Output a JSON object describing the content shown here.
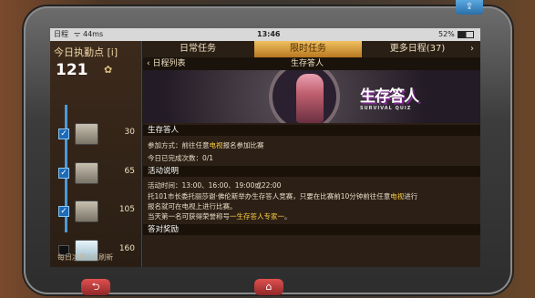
{
  "status": {
    "carrier": "日程",
    "time_wifi": "44ms",
    "clock": "13:46",
    "battery": "52%"
  },
  "left": {
    "title": "今日执勤点",
    "info": "[i]",
    "points": "121",
    "items": [
      {
        "value": "30",
        "checked": true
      },
      {
        "value": "65",
        "checked": true
      },
      {
        "value": "105",
        "checked": true
      },
      {
        "value": "160",
        "checked": false
      }
    ],
    "footer": "每日凌晨3点刷新"
  },
  "tabs": [
    "日常任务",
    "限时任务",
    "更多日程(37)"
  ],
  "subheader": {
    "back_label": "日程列表",
    "title": "生存答人"
  },
  "banner": {
    "logo": "生存答人",
    "logo_en": "SURVIVAL QUIZ"
  },
  "detail": {
    "name": "生存答人",
    "method_prefix": "参加方式：前往任意",
    "method_hl": "电视",
    "method_suffix": "报名参加比赛",
    "progress": "今日已完成次数：0/1",
    "section2": "活动说明",
    "time": "活动时间：13:00、16:00、19:00或22:00",
    "desc1a": "托101市长委托丽莎谢·佛伦斯举办生存答人竞赛，只要在比赛前10分钟前往任意",
    "desc1b": "电视",
    "desc1c": "进行",
    "desc2": "报名就可在电视上进行比赛。",
    "desc3a": "当天第一名可获得荣誉称号",
    "desc3b": "一生存答人专家一",
    "desc3c": "。",
    "section3": "答对奖励"
  },
  "buttons": {
    "top": "⇪",
    "back": "⮌",
    "home": "⌂"
  }
}
